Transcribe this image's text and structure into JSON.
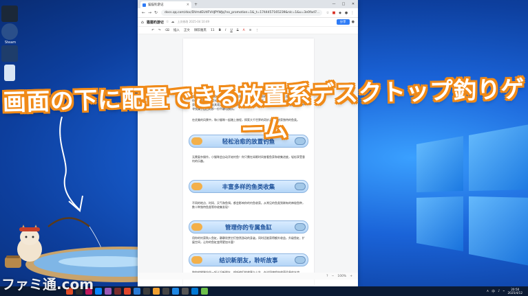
{
  "headline": "画面の下に配置できる放置系デスクトップ釣りゲーム",
  "watermark": "ファミ通.com",
  "desktop_icons": [
    {
      "label": "Steam",
      "color": "#1b2838"
    },
    {
      "label": "",
      "color": "#2a4f8a"
    },
    {
      "label": "",
      "color": "#d9e6f5"
    }
  ],
  "browser": {
    "tab_title": "猫猫钓游记",
    "tab_close": "×",
    "new_tab": "+",
    "window_controls": [
      "—",
      "□",
      "✕"
    ],
    "nav": {
      "back": "←",
      "forward": "→",
      "reload": "↻"
    },
    "url": "docs.qq.com/doc/DVmdEUtIFVHJPYWJq?no_promotion=1&_t=1744457165239&nlc=1&u=3e0fad7...",
    "doc": {
      "home_icon": "⌂",
      "title": "猫猫钓游记",
      "meta": "上次修改 2025-04 10:49",
      "share_label": "分享",
      "toolbar": [
        "↶",
        "↷",
        "⌫",
        "插入",
        "正文",
        "微软雅黑",
        "11",
        "B",
        "I",
        "U",
        "S",
        "A",
        "≡",
        "⋮"
      ]
    },
    "page": {
      "paragraphs": [
        "欢迎来到《猫猫钓游记》，唯心猫猫悠然挥竿，让你成为你的猫世界里与世无争生活的乐趣。你可以利用闲暇时光来观看猫猫钓鱼，或是放下手中的事项，在悠闲的氛围中享受每一次收获，仿佛自己身临其境。随着钓鱼次数的增加，猫猫会解锁更多的装备与收藏，在悠然自得中寻找属于自己的那一份平静与快乐。",
        "在优美的风景中，和小猫咪一起踏上旅程，探索大千世界的奇妙之处，收获独特的鱼类。",
        "无需复杂操作，小猫咪会自动开始钓鱼！你只需在闲暇时间查看鱼获和收集进度，轻松享受垂钓的乐趣。",
        "不同的地点、时间、天气和鱼饵，都会影响你的钓鱼收获。从常见的鱼类到稀有的神秘鱼种，数十种独特鱼类等你收集发现！",
        "用你的钓获购入鱼缸，静静欣赏它们悠然游动的身姿。同时还能获得额外收益，升级鱼缸、扩展空间，让你的鱼缸变得更加丰富！",
        "和你的猫咪伙伴一起认识新朋友，倾听他们的故事与人生，在这段旅程中收获珍贵的友谊。"
      ],
      "banners": [
        "轻松治愈的放置钓鱼",
        "丰富多样的鱼类收集",
        "管理你的专属鱼缸",
        "结识新朋友，聆听故事"
      ]
    },
    "status": {
      "zoom": "100%",
      "zoom_minus": "−",
      "zoom_plus": "+",
      "help": "?"
    }
  },
  "taskbar": {
    "apps": [
      "#e34c26",
      "#2b2b2b",
      "#c2185b",
      "#0a84ff",
      "#9b59b6",
      "#7a2c2c",
      "#e0462b",
      "#2b7bd6",
      "#3c3c3c",
      "#f0a030",
      "#444444",
      "#1e88e5",
      "#555555",
      "#0078d4",
      "#6cc04a"
    ],
    "tray": [
      "∧",
      "中",
      "♪",
      "⌁"
    ],
    "time": "20:50",
    "date": "2025/4/12"
  },
  "colors": {
    "headline_fill": "#ffffff",
    "headline_outline": "#f08a18",
    "banner_text": "#1b4f99",
    "share_button": "#2f7cf6"
  }
}
